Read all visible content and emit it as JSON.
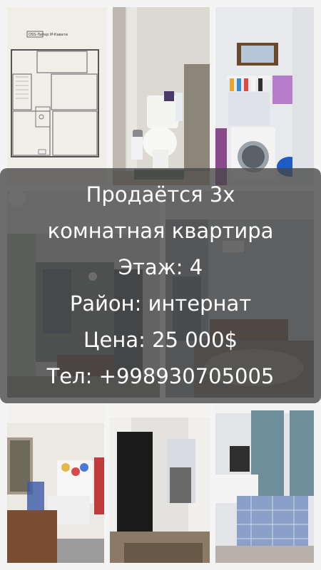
{
  "listing": {
    "title_line1": "Продаётся 3х",
    "title_line2": "комнатная квартира",
    "floor": "Этаж: 4",
    "district": "Район: интернат",
    "price": "Цена: 25 000$",
    "phone": "Тел: +998930705005"
  },
  "photos": [
    {
      "name": "floor-plan-photo",
      "caption": "OSS-Литер IP-Кавати"
    },
    {
      "name": "toilet-photo"
    },
    {
      "name": "laundry-photo"
    },
    {
      "name": "hallway-photo"
    },
    {
      "name": "bedroom-carpet-photo"
    },
    {
      "name": "kids-room-photo"
    },
    {
      "name": "doorway-curtains-photo"
    },
    {
      "name": "bedroom-bed-photo"
    }
  ]
}
